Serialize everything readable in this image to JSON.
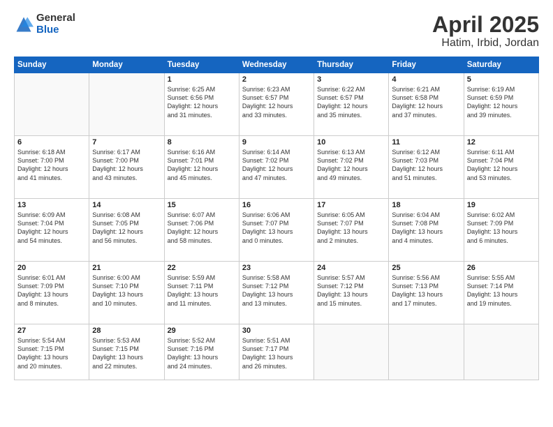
{
  "header": {
    "logo_general": "General",
    "logo_blue": "Blue",
    "month": "April 2025",
    "location": "Hatim, Irbid, Jordan"
  },
  "weekdays": [
    "Sunday",
    "Monday",
    "Tuesday",
    "Wednesday",
    "Thursday",
    "Friday",
    "Saturday"
  ],
  "weeks": [
    [
      {
        "day": "",
        "info": ""
      },
      {
        "day": "",
        "info": ""
      },
      {
        "day": "1",
        "info": "Sunrise: 6:25 AM\nSunset: 6:56 PM\nDaylight: 12 hours\nand 31 minutes."
      },
      {
        "day": "2",
        "info": "Sunrise: 6:23 AM\nSunset: 6:57 PM\nDaylight: 12 hours\nand 33 minutes."
      },
      {
        "day": "3",
        "info": "Sunrise: 6:22 AM\nSunset: 6:57 PM\nDaylight: 12 hours\nand 35 minutes."
      },
      {
        "day": "4",
        "info": "Sunrise: 6:21 AM\nSunset: 6:58 PM\nDaylight: 12 hours\nand 37 minutes."
      },
      {
        "day": "5",
        "info": "Sunrise: 6:19 AM\nSunset: 6:59 PM\nDaylight: 12 hours\nand 39 minutes."
      }
    ],
    [
      {
        "day": "6",
        "info": "Sunrise: 6:18 AM\nSunset: 7:00 PM\nDaylight: 12 hours\nand 41 minutes."
      },
      {
        "day": "7",
        "info": "Sunrise: 6:17 AM\nSunset: 7:00 PM\nDaylight: 12 hours\nand 43 minutes."
      },
      {
        "day": "8",
        "info": "Sunrise: 6:16 AM\nSunset: 7:01 PM\nDaylight: 12 hours\nand 45 minutes."
      },
      {
        "day": "9",
        "info": "Sunrise: 6:14 AM\nSunset: 7:02 PM\nDaylight: 12 hours\nand 47 minutes."
      },
      {
        "day": "10",
        "info": "Sunrise: 6:13 AM\nSunset: 7:02 PM\nDaylight: 12 hours\nand 49 minutes."
      },
      {
        "day": "11",
        "info": "Sunrise: 6:12 AM\nSunset: 7:03 PM\nDaylight: 12 hours\nand 51 minutes."
      },
      {
        "day": "12",
        "info": "Sunrise: 6:11 AM\nSunset: 7:04 PM\nDaylight: 12 hours\nand 53 minutes."
      }
    ],
    [
      {
        "day": "13",
        "info": "Sunrise: 6:09 AM\nSunset: 7:04 PM\nDaylight: 12 hours\nand 54 minutes."
      },
      {
        "day": "14",
        "info": "Sunrise: 6:08 AM\nSunset: 7:05 PM\nDaylight: 12 hours\nand 56 minutes."
      },
      {
        "day": "15",
        "info": "Sunrise: 6:07 AM\nSunset: 7:06 PM\nDaylight: 12 hours\nand 58 minutes."
      },
      {
        "day": "16",
        "info": "Sunrise: 6:06 AM\nSunset: 7:07 PM\nDaylight: 13 hours\nand 0 minutes."
      },
      {
        "day": "17",
        "info": "Sunrise: 6:05 AM\nSunset: 7:07 PM\nDaylight: 13 hours\nand 2 minutes."
      },
      {
        "day": "18",
        "info": "Sunrise: 6:04 AM\nSunset: 7:08 PM\nDaylight: 13 hours\nand 4 minutes."
      },
      {
        "day": "19",
        "info": "Sunrise: 6:02 AM\nSunset: 7:09 PM\nDaylight: 13 hours\nand 6 minutes."
      }
    ],
    [
      {
        "day": "20",
        "info": "Sunrise: 6:01 AM\nSunset: 7:09 PM\nDaylight: 13 hours\nand 8 minutes."
      },
      {
        "day": "21",
        "info": "Sunrise: 6:00 AM\nSunset: 7:10 PM\nDaylight: 13 hours\nand 10 minutes."
      },
      {
        "day": "22",
        "info": "Sunrise: 5:59 AM\nSunset: 7:11 PM\nDaylight: 13 hours\nand 11 minutes."
      },
      {
        "day": "23",
        "info": "Sunrise: 5:58 AM\nSunset: 7:12 PM\nDaylight: 13 hours\nand 13 minutes."
      },
      {
        "day": "24",
        "info": "Sunrise: 5:57 AM\nSunset: 7:12 PM\nDaylight: 13 hours\nand 15 minutes."
      },
      {
        "day": "25",
        "info": "Sunrise: 5:56 AM\nSunset: 7:13 PM\nDaylight: 13 hours\nand 17 minutes."
      },
      {
        "day": "26",
        "info": "Sunrise: 5:55 AM\nSunset: 7:14 PM\nDaylight: 13 hours\nand 19 minutes."
      }
    ],
    [
      {
        "day": "27",
        "info": "Sunrise: 5:54 AM\nSunset: 7:15 PM\nDaylight: 13 hours\nand 20 minutes."
      },
      {
        "day": "28",
        "info": "Sunrise: 5:53 AM\nSunset: 7:15 PM\nDaylight: 13 hours\nand 22 minutes."
      },
      {
        "day": "29",
        "info": "Sunrise: 5:52 AM\nSunset: 7:16 PM\nDaylight: 13 hours\nand 24 minutes."
      },
      {
        "day": "30",
        "info": "Sunrise: 5:51 AM\nSunset: 7:17 PM\nDaylight: 13 hours\nand 26 minutes."
      },
      {
        "day": "",
        "info": ""
      },
      {
        "day": "",
        "info": ""
      },
      {
        "day": "",
        "info": ""
      }
    ]
  ]
}
